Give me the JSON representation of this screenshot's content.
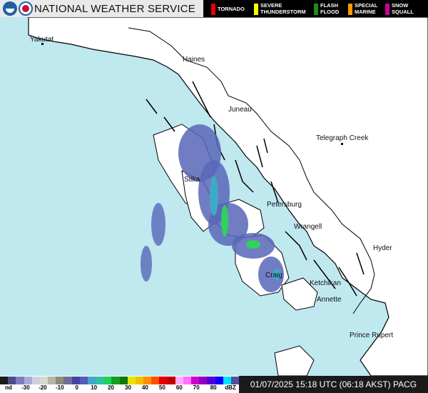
{
  "header": {
    "title": "NATIONAL WEATHER SERVICE",
    "legend": [
      {
        "label": "TORNADO",
        "color": "#e60000"
      },
      {
        "label": "SEVERE\nTHUNDERSTORM",
        "color": "#ffff00"
      },
      {
        "label": "FLASH\nFLOOD",
        "color": "#1e8b1e"
      },
      {
        "label": "SPECIAL\nMARINE",
        "color": "#ff9900"
      },
      {
        "label": "SNOW\nSQUALL",
        "color": "#cc0099"
      }
    ]
  },
  "map": {
    "places": [
      "Yakutat",
      "Haines",
      "Juneau",
      "Telegraph Creek",
      "Sitka",
      "Petersburg",
      "Wrangell",
      "Hyder",
      "Craig",
      "Ketchikan",
      "Annette",
      "Prince Rupert"
    ],
    "colors": {
      "ocean": "#bfe8ef",
      "land": "#ffffff",
      "coast": "#000000",
      "radar_low": "#5866b8",
      "radar_mid": "#3fa9c8",
      "radar_high": "#2fd25a"
    }
  },
  "colorbar": {
    "labels": [
      "nd",
      "-30",
      "-20",
      "-10",
      "0",
      "10",
      "20",
      "30",
      "40",
      "50",
      "60",
      "70",
      "80",
      "dBZ"
    ],
    "colors": [
      "#1a1a1a",
      "#4b4b8a",
      "#7d7dc0",
      "#a9a9d6",
      "#cfcfe6",
      "#d8d8cf",
      "#b5b5a4",
      "#8d8d7e",
      "#6e6e96",
      "#4444a8",
      "#5a5ab8",
      "#3fa9c8",
      "#2fbfb0",
      "#1ed25a",
      "#12a01c",
      "#0b7a10",
      "#e6e600",
      "#f2c000",
      "#ff9000",
      "#ff5000",
      "#e60000",
      "#c00000",
      "#ffb0ff",
      "#ff70ff",
      "#d000d0",
      "#9000c0",
      "#5000e0",
      "#0000ff",
      "#00e0ff",
      "#5050a0"
    ]
  },
  "footer": {
    "timestamp": "01/07/2025 15:18 UTC (06:18 AKST) PACG"
  }
}
